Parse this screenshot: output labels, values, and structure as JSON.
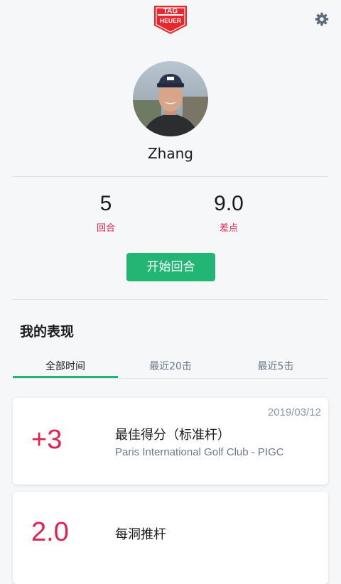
{
  "header": {
    "logo_top": "TAG",
    "logo_bottom": "HEUER",
    "brand_color": "#e8262b",
    "accent_color": "#22b573"
  },
  "profile": {
    "name": "Zhang"
  },
  "stats": [
    {
      "value": "5",
      "label": "回合"
    },
    {
      "value": "9.0",
      "label": "差点"
    }
  ],
  "start_button_label": "开始回合",
  "performance": {
    "title": "我的表现",
    "tabs": [
      {
        "label": "全部时间",
        "active": true
      },
      {
        "label": "最近20击",
        "active": false
      },
      {
        "label": "最近5击",
        "active": false
      }
    ],
    "cards": [
      {
        "date": "2019/03/12",
        "value": "+3",
        "title": "最佳得分（标准杆）",
        "subtitle": "Paris International Golf Club - PIGC"
      },
      {
        "value": "2.0",
        "title": "每洞推杆"
      }
    ]
  }
}
